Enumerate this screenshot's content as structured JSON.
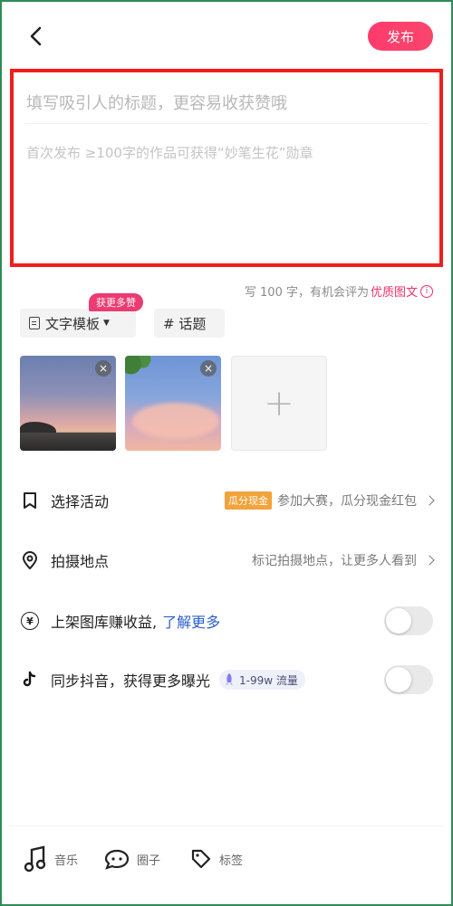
{
  "header": {
    "publish_label": "发布"
  },
  "editor": {
    "title_placeholder": "填写吸引人的标题，更容易收获赞哦",
    "body_placeholder": "首次发布 ≥100字的作品可获得“妙笔生花”勋章"
  },
  "hint": {
    "text": "写 100 字，有机会评为",
    "highlight": "优质图文",
    "icon": "info-icon"
  },
  "chips": {
    "template_label": "文字模板",
    "template_badge": "获更多赞",
    "topic_label": "# 话题"
  },
  "images": [
    {
      "name": "sunset-river-photo",
      "remove_glyph": "×"
    },
    {
      "name": "sky-clouds-photo",
      "remove_glyph": "×"
    }
  ],
  "add_image_glyph": "+",
  "rows": {
    "activity": {
      "label": "选择活动",
      "tag": "瓜分现金",
      "detail": "参加大赛，瓜分现金红包"
    },
    "location": {
      "label": "拍摄地点",
      "detail": "标记拍摄地点，让更多人看到"
    },
    "gallery": {
      "label": "上架图库赚收益,",
      "link": "了解更多",
      "icon_glyph": "¥",
      "toggle_on": false
    },
    "douyin": {
      "label": "同步抖音，获得更多曝光",
      "badge": "1-99w 流量",
      "toggle_on": false
    }
  },
  "bottom_tools": [
    {
      "label": "音乐",
      "icon": "music-note-icon"
    },
    {
      "label": "圈子",
      "icon": "circle-chat-icon"
    },
    {
      "label": "标签",
      "icon": "tag-icon"
    }
  ],
  "colors": {
    "accent": "#ff3b6b",
    "highlight_border": "#f11d1d",
    "link": "#2a5fd0",
    "cash_tag": "#f2a33b"
  }
}
